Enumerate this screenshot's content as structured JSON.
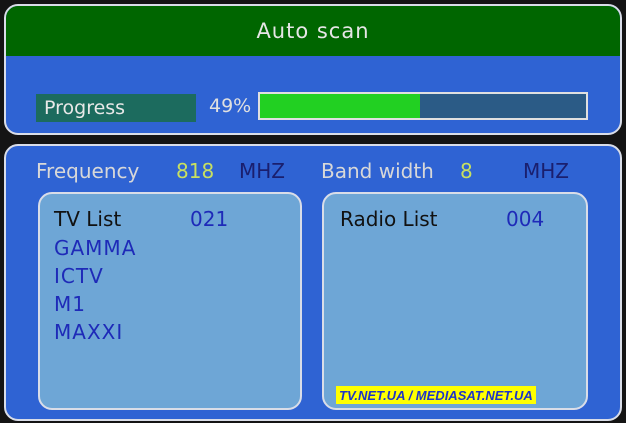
{
  "header": {
    "title": "Auto scan"
  },
  "progress": {
    "label": "Progress",
    "percent_text": "49%",
    "value": 0.49
  },
  "frequency": {
    "label": "Frequency",
    "value": "818",
    "unit": "MHZ"
  },
  "bandwidth": {
    "label": "Band width",
    "value": "8",
    "unit": "MHZ"
  },
  "tv_list": {
    "title": "TV List",
    "count": "021",
    "channels": [
      "GAMMA",
      "ICTV",
      "M1",
      "MAXXI"
    ]
  },
  "radio_list": {
    "title": "Radio List",
    "count": "004",
    "channels": []
  },
  "watermark": "TV.NET.UA / MEDIASAT.NET.UA",
  "colors": {
    "panel_bg": "#2f63d3",
    "title_bar": "#006600",
    "progress_fill": "#22d022",
    "list_bg": "#6ea6d6",
    "channel_text": "#1e2ab8"
  }
}
